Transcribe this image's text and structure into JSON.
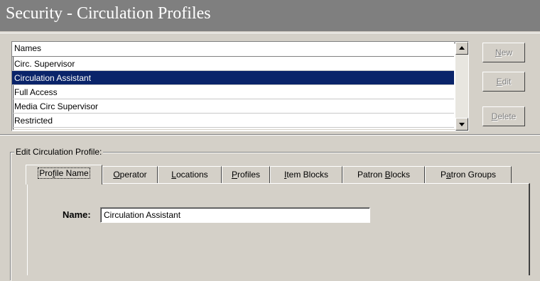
{
  "window": {
    "title": "Security - Circulation Profiles"
  },
  "list": {
    "header": "Names",
    "items": [
      {
        "label": "Circ. Supervisor",
        "selected": false
      },
      {
        "label": "Circulation Assistant",
        "selected": true
      },
      {
        "label": "Full Access",
        "selected": false
      },
      {
        "label": "Media Circ Supervisor",
        "selected": false
      },
      {
        "label": "Restricted",
        "selected": false
      }
    ]
  },
  "buttons": {
    "new": {
      "pre": "",
      "key": "N",
      "post": "ew"
    },
    "edit": {
      "pre": "",
      "key": "E",
      "post": "dit"
    },
    "delete": {
      "pre": "",
      "key": "D",
      "post": "elete"
    }
  },
  "group": {
    "label": "Edit  Circulation Profile:"
  },
  "tabs": [
    {
      "pre": "Pro",
      "key": "f",
      "post": "ile Name",
      "active": true
    },
    {
      "pre": "",
      "key": "O",
      "post": "perator",
      "active": false
    },
    {
      "pre": "",
      "key": "L",
      "post": "ocations",
      "active": false
    },
    {
      "pre": "",
      "key": "P",
      "post": "rofiles",
      "active": false
    },
    {
      "pre": "",
      "key": "I",
      "post": "tem Blocks",
      "active": false
    },
    {
      "pre": "Patron ",
      "key": "B",
      "post": "locks",
      "active": false
    },
    {
      "pre": "P",
      "key": "a",
      "post": "tron Groups",
      "active": false
    }
  ],
  "form": {
    "name_label": "Name:",
    "name_value": "Circulation Assistant"
  },
  "colors": {
    "selection": "#0a246a",
    "face": "#d4d0c8",
    "title_bg": "#7f7f7f"
  }
}
